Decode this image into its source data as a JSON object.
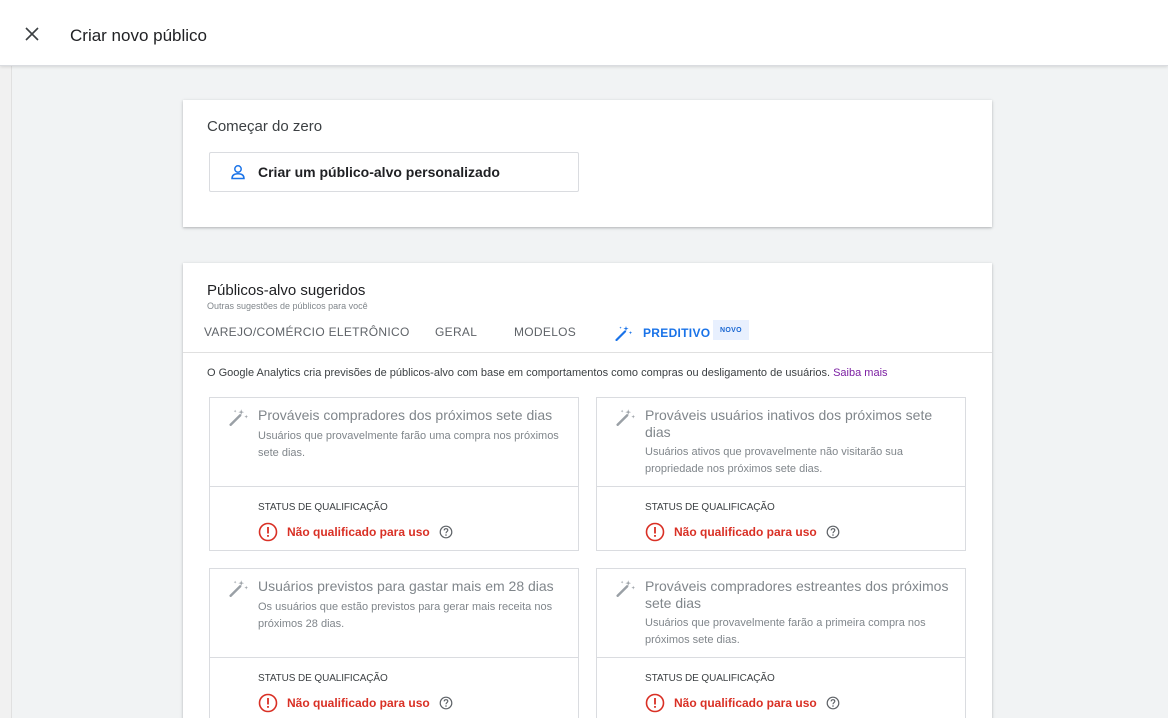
{
  "header": {
    "title": "Criar novo público"
  },
  "start": {
    "heading": "Começar do zero",
    "create_label": "Criar um público-alvo personalizado"
  },
  "suggested": {
    "heading": "Públicos-alvo sugeridos",
    "subheading": "Outras sugestões de públicos para você",
    "tabs": [
      {
        "label": "VAREJO/COMÉRCIO ELETRÔNICO"
      },
      {
        "label": "GERAL"
      },
      {
        "label": "MODELOS"
      },
      {
        "label": "PREDITIVO"
      }
    ],
    "badge": "NOVO",
    "info_text": "O Google Analytics cria previsões de públicos-alvo com base em comportamentos como compras ou desligamento de usuários.",
    "info_link": "Saiba mais",
    "cards": [
      {
        "title": "Prováveis compradores dos próximos sete dias",
        "desc": "Usuários que provavelmente farão uma compra nos próximos sete dias.",
        "status_label": "STATUS DE QUALIFICAÇÃO",
        "status": "Não qualificado para uso"
      },
      {
        "title": "Prováveis usuários inativos dos próximos sete dias",
        "desc": "Usuários ativos que provavelmente não visitarão sua propriedade nos próximos sete dias.",
        "status_label": "STATUS DE QUALIFICAÇÃO",
        "status": "Não qualificado para uso"
      },
      {
        "title": "Usuários previstos para gastar mais em 28 dias",
        "desc": "Os usuários que estão previstos para gerar mais receita nos próximos 28 dias.",
        "status_label": "STATUS DE QUALIFICAÇÃO",
        "status": "Não qualificado para uso"
      },
      {
        "title": "Prováveis compradores estreantes dos próximos sete dias",
        "desc": "Usuários que provavelmente farão a primeira compra nos próximos sete dias.",
        "status_label": "STATUS DE QUALIFICAÇÃO",
        "status": "Não qualificado para uso"
      }
    ]
  },
  "colors": {
    "accent": "#1a73e8",
    "error": "#d93025",
    "link": "#7b1fa2",
    "badge_bg": "#e8f0fe"
  },
  "icons": [
    "close-icon",
    "person-icon",
    "magic-wand-icon",
    "error-icon",
    "help-icon"
  ]
}
